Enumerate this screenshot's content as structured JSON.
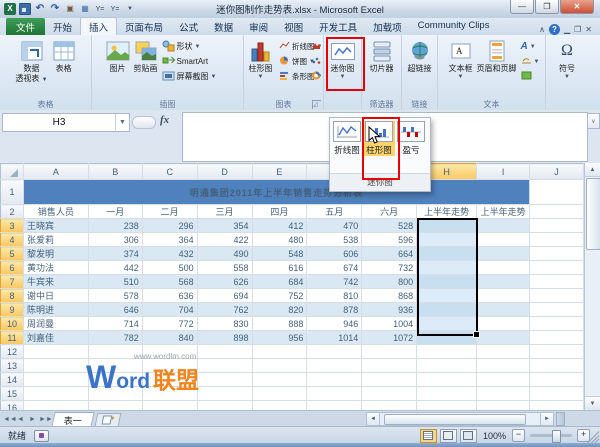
{
  "window": {
    "title": "迷你图制作走势表.xlsx - Microsoft Excel"
  },
  "tabs": {
    "file": "文件",
    "items": [
      "开始",
      "插入",
      "页面布局",
      "公式",
      "数据",
      "审阅",
      "视图",
      "开发工具",
      "加载项",
      "Community Clips"
    ],
    "active": "插入"
  },
  "ribbon": {
    "pivot_l1": "数据",
    "pivot_l2": "透视表",
    "table": "表格",
    "picture": "图片",
    "clipart": "剪贴画",
    "shapes": "形状",
    "smartart": "SmartArt",
    "screenshot": "屏幕截图",
    "column": "柱形图",
    "line": "折线图",
    "pie": "饼图",
    "bar": "条形图",
    "sparkline": "迷你图",
    "slicer": "切片器",
    "hyperlink": "超链接",
    "textbox": "文本框",
    "headerfooter": "页眉和页脚",
    "symbol": "符号",
    "omega": "Ω",
    "g_tables": "表格",
    "g_illustrations": "插图",
    "g_charts": "图表",
    "g_filter": "筛选器",
    "g_links": "链接",
    "g_text": "文本"
  },
  "sparkline_menu": {
    "line": "折线图",
    "column": "柱形图",
    "winloss": "盈亏",
    "footer": "迷你图"
  },
  "formula_bar": {
    "name_box": "H3",
    "fx": "fx"
  },
  "grid": {
    "columns": [
      "A",
      "B",
      "C",
      "D",
      "E",
      "F",
      "G",
      "H",
      "I",
      "J"
    ],
    "selected_column": "H",
    "selected_range": "H3:H11",
    "title": "明通集团2011年上半年销售走势分析表",
    "headers": [
      "销售人员",
      "一月",
      "二月",
      "三月",
      "四月",
      "五月",
      "六月",
      "上半年走势",
      "上半年走势"
    ],
    "rows": [
      {
        "name": "王晓宾",
        "values": [
          238,
          296,
          354,
          412,
          470,
          528
        ]
      },
      {
        "name": "张爱莉",
        "values": [
          306,
          364,
          422,
          480,
          538,
          596
        ]
      },
      {
        "name": "黎发明",
        "values": [
          374,
          432,
          490,
          548,
          606,
          664
        ]
      },
      {
        "name": "黄功法",
        "values": [
          442,
          500,
          558,
          616,
          674,
          732
        ]
      },
      {
        "name": "牛宾来",
        "values": [
          510,
          568,
          626,
          684,
          742,
          800
        ]
      },
      {
        "name": "谢中日",
        "values": [
          578,
          636,
          694,
          752,
          810,
          868
        ]
      },
      {
        "name": "陈明进",
        "values": [
          646,
          704,
          762,
          820,
          878,
          936
        ]
      },
      {
        "name": "周润曼",
        "values": [
          714,
          772,
          830,
          888,
          946,
          1004
        ]
      },
      {
        "name": "刘嘉佳",
        "values": [
          782,
          840,
          898,
          956,
          1014,
          1072
        ]
      }
    ],
    "first_data_row": 3,
    "last_visible_row": 17
  },
  "watermark": {
    "url": "www.wordlm.com",
    "brand_latin_initial": "W",
    "brand_latin_rest": "ord",
    "brand_cjk": "联盟"
  },
  "sheet_tabs": {
    "active": "表一"
  },
  "status_bar": {
    "ready": "就绪",
    "zoom": "100%"
  },
  "colors": {
    "accent_blue": "#4f81bd",
    "band_blue": "#d9e8f2",
    "highlight_red": "#e60000",
    "gallery_orange": "#fcd46d",
    "header_gold": "#fbc75f"
  }
}
